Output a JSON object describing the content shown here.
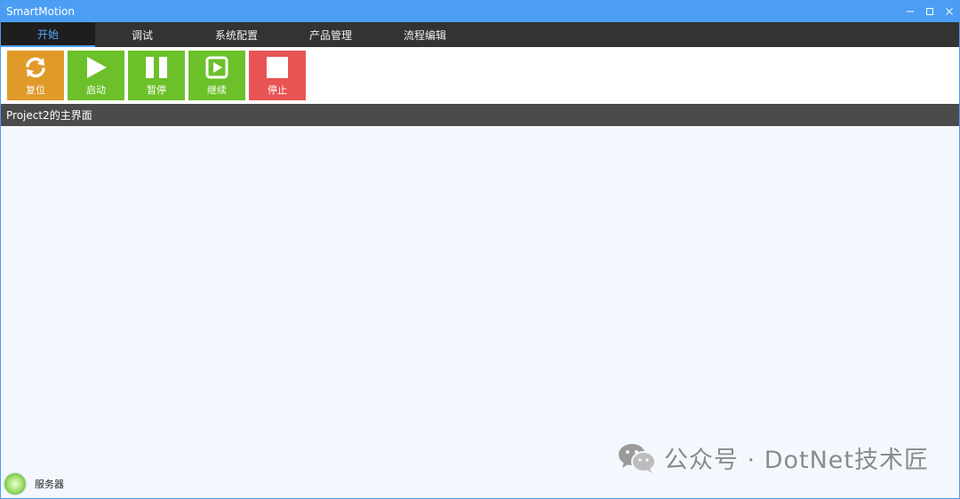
{
  "window": {
    "title": "SmartMotion"
  },
  "tabs": [
    {
      "label": "开始"
    },
    {
      "label": "调试"
    },
    {
      "label": "系统配置"
    },
    {
      "label": "产品管理"
    },
    {
      "label": "流程编辑"
    }
  ],
  "toolbar": {
    "reset_label": "复位",
    "start_label": "启动",
    "pause_label": "暂停",
    "resume_label": "继续",
    "stop_label": "停止"
  },
  "colors": {
    "titlebar": "#4c9ef5",
    "reset": "#e09a2a",
    "start": "#6cc02a",
    "pause": "#6cc02a",
    "resume": "#6cc02a",
    "stop": "#e85454",
    "server_led": "#8fd659"
  },
  "section": {
    "title": "Project2的主界面"
  },
  "status": {
    "server_label": "服务器"
  },
  "watermark": {
    "text": "公众号 · DotNet技术匠"
  }
}
